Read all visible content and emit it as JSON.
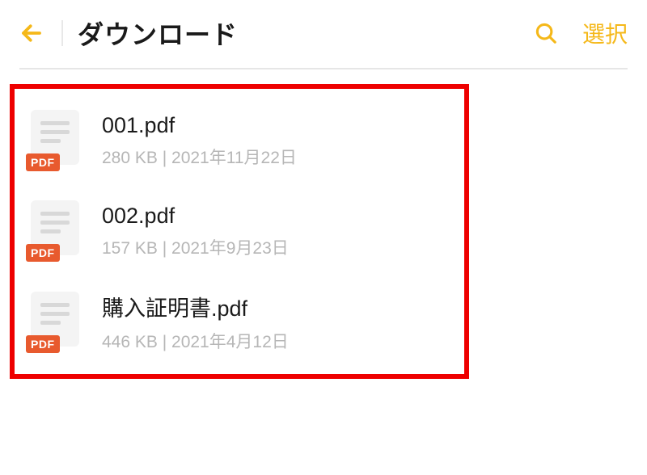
{
  "header": {
    "title": "ダウンロード",
    "select_label": "選択"
  },
  "pdf_badge_label": "PDF",
  "meta_separator": " | ",
  "files": [
    {
      "name": "001.pdf",
      "size": "280 KB",
      "date": "2021年11月22日"
    },
    {
      "name": "002.pdf",
      "size": "157 KB",
      "date": "2021年9月23日"
    },
    {
      "name": "購入証明書.pdf",
      "size": "446 KB",
      "date": "2021年4月12日"
    }
  ]
}
